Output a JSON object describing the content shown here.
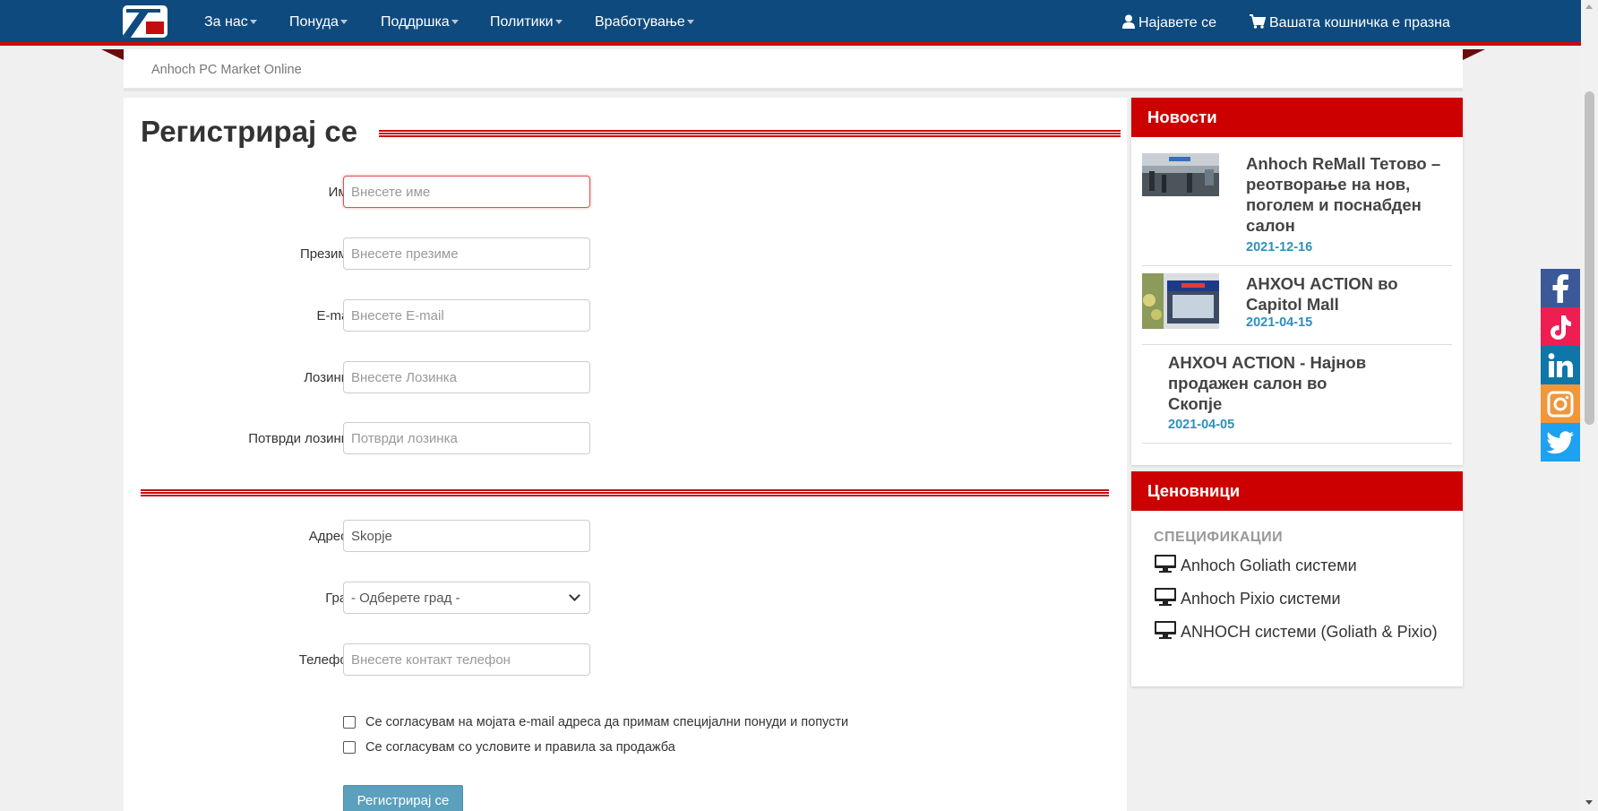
{
  "nav": {
    "menu": [
      {
        "label": "За нас"
      },
      {
        "label": "Понуда"
      },
      {
        "label": "Поддршка"
      },
      {
        "label": "Политики"
      },
      {
        "label": "Вработување"
      }
    ],
    "login_label": "Најавете се",
    "cart_label": "Вашата кошничка е празна"
  },
  "breadcrumb": "Anhoch PC Market Online",
  "form": {
    "title": "Регистрирај се",
    "fields": [
      {
        "label": "Име",
        "placeholder": "Внесете име",
        "value": ""
      },
      {
        "label": "Презиме",
        "placeholder": "Внесете презиме",
        "value": ""
      },
      {
        "label": "E-mail",
        "placeholder": "Внесете E-mail",
        "value": ""
      },
      {
        "label": "Лозинка",
        "placeholder": "Внесете Лозинка",
        "value": ""
      },
      {
        "label": "Потврди лозинка",
        "placeholder": "Потврди лозинка",
        "value": ""
      }
    ],
    "address": {
      "label": "Адреса",
      "value": "Skopje"
    },
    "city": {
      "label": "Град",
      "selected": "- Одберете град -"
    },
    "phone": {
      "label": "Телефон",
      "placeholder": "Внесете контакт телефон",
      "value": ""
    },
    "checks": [
      {
        "label": "Се согласувам на мојата e-mail адреса да примам специјални понуди и попусти",
        "checked": false
      },
      {
        "label": "Се согласувам со условите и правила за продажба",
        "checked": false
      }
    ],
    "submit_label": "Регистрирај се"
  },
  "news": {
    "heading": "Новости",
    "items": [
      {
        "title": "Anhoch ReMall Тетово – реотворање на нов, поголем и поснабден салон",
        "date": "2021-12-16"
      },
      {
        "title": "АНХОЧ ACTION во Capitol Mall",
        "date": "2021-04-15"
      },
      {
        "title": "АНХОЧ ACTION - Најнов продажен салон во Скопје",
        "date": "2021-04-05"
      }
    ]
  },
  "pricelists": {
    "heading": "Ценовници",
    "subheading": "СПЕЦИФИКАЦИИ",
    "items": [
      {
        "label": "Anhoch Goliath системи"
      },
      {
        "label": "Anhoch Pixio системи"
      },
      {
        "label": "ANHOCH системи (Goliath & Pixio)"
      }
    ]
  },
  "social": [
    {
      "icon": "facebook-icon",
      "color": "#3b5998"
    },
    {
      "icon": "tiktok-icon",
      "color": "#ee1d52"
    },
    {
      "icon": "linkedin-icon",
      "color": "#0e76a8"
    },
    {
      "icon": "instagram-icon",
      "color": "#f0963b"
    },
    {
      "icon": "twitter-icon",
      "color": "#1da1f2"
    }
  ],
  "colors": {
    "brand_blue": "#0e4a7e",
    "brand_red": "#cc0000",
    "link_blue": "#2f8fbd",
    "button": "#5ba0bd"
  }
}
